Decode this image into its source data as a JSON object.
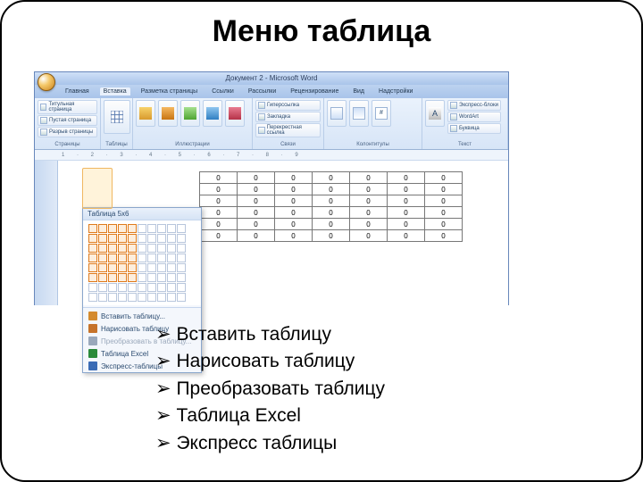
{
  "slide_title": "Меню таблица",
  "word": {
    "titlebar": "Документ 2 - Microsoft Word",
    "tabs": [
      "Главная",
      "Вставка",
      "Разметка страницы",
      "Ссылки",
      "Рассылки",
      "Рецензирование",
      "Вид",
      "Надстройки"
    ],
    "active_tab_index": 1,
    "ribbon_groups": {
      "pages": {
        "label": "Страницы",
        "items": [
          "Титульная страница",
          "Пустая страница",
          "Разрыв страницы"
        ]
      },
      "tables": {
        "label": "Таблицы",
        "button": "Таблица"
      },
      "illustrations": {
        "label": "Иллюстрации",
        "big": [
          "Рисунок",
          "Клип",
          "Фигуры",
          "SmartArt",
          "Диаграмма"
        ]
      },
      "links": {
        "label": "Связи",
        "items": [
          "Гиперссылка",
          "Закладка",
          "Перекрестная ссылка"
        ]
      },
      "header_footer": {
        "label": "Колонтитулы",
        "big": [
          "Верхний колонтитул",
          "Нижний колонтитул",
          "Номер страницы"
        ]
      },
      "text": {
        "label": "Текст",
        "big": "Надпись",
        "items": [
          "Экспресс-блоки",
          "WordArt",
          "Буквица"
        ]
      }
    },
    "ruler": "1 · 2 · 3 · 4 · 5 · 6 · 7 · 8 · 9",
    "table_menu": {
      "title": "Таблица 5x6",
      "grid_cols": 10,
      "grid_rows": 8,
      "sel_cols": 5,
      "sel_rows": 6,
      "items": [
        {
          "label": "Вставить таблицу...",
          "dim": false
        },
        {
          "label": "Нарисовать таблицу",
          "dim": false
        },
        {
          "label": "Преобразовать в таблицу...",
          "dim": true
        },
        {
          "label": "Таблица Excel",
          "dim": false
        },
        {
          "label": "Экспресс-таблицы",
          "dim": false
        }
      ]
    },
    "sample_table": {
      "rows": 6,
      "cols": 7,
      "cell_value": "0"
    }
  },
  "bullets": [
    "Вставить таблицу",
    "Нарисовать таблицу",
    "Преобразовать таблицу",
    "Таблица Excel",
    "Экспресс таблицы"
  ]
}
